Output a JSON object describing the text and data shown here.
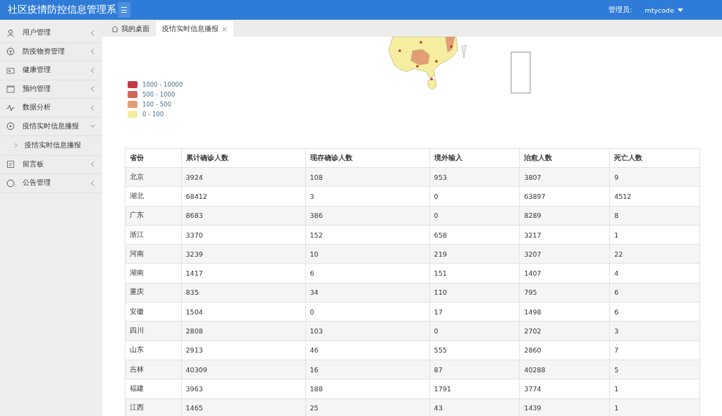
{
  "header": {
    "title": "社区疫情防控信息管理系",
    "menu_toggle": "☰",
    "user_label": "管理员:",
    "user_name": "mtycode"
  },
  "sidebar": {
    "items": [
      {
        "label": "用户管理",
        "expanded": false
      },
      {
        "label": "防疫物资管理",
        "expanded": false
      },
      {
        "label": "健康管理",
        "expanded": false
      },
      {
        "label": "预约管理",
        "expanded": false
      },
      {
        "label": "数据分析",
        "expanded": false
      },
      {
        "label": "疫情实时信息播报",
        "expanded": true,
        "children": [
          {
            "label": "疫情实时信息播报"
          }
        ]
      },
      {
        "label": "留言板",
        "expanded": false
      },
      {
        "label": "公告管理",
        "expanded": false
      }
    ]
  },
  "tabs": [
    {
      "label": "我的桌面",
      "kind": "home",
      "selected": false
    },
    {
      "label": "疫情实时信息播报",
      "kind": "closable",
      "selected": true,
      "close": "×"
    }
  ],
  "legend": [
    {
      "label": "1000 - 10000",
      "color": "#c23b45"
    },
    {
      "label": "500 - 1000",
      "color": "#d2685a"
    },
    {
      "label": "100 - 500",
      "color": "#e29d74"
    },
    {
      "label": "0 - 100",
      "color": "#f5eda0"
    }
  ],
  "table": {
    "columns": [
      "省份",
      "累计确诊人数",
      "现存确诊人数",
      "境外输入",
      "治愈人数",
      "死亡人数"
    ],
    "rows": [
      [
        "北京",
        "3924",
        "108",
        "953",
        "3807",
        "9"
      ],
      [
        "湖北",
        "68412",
        "3",
        "0",
        "63897",
        "4512"
      ],
      [
        "广东",
        "8683",
        "386",
        "0",
        "8289",
        "8"
      ],
      [
        "浙江",
        "3370",
        "152",
        "658",
        "3217",
        "1"
      ],
      [
        "河南",
        "3239",
        "10",
        "219",
        "3207",
        "22"
      ],
      [
        "湖南",
        "1417",
        "6",
        "151",
        "1407",
        "4"
      ],
      [
        "重庆",
        "835",
        "34",
        "110",
        "795",
        "6"
      ],
      [
        "安徽",
        "1504",
        "0",
        "17",
        "1498",
        "6"
      ],
      [
        "四川",
        "2808",
        "103",
        "0",
        "2702",
        "3"
      ],
      [
        "山东",
        "2913",
        "46",
        "555",
        "2860",
        "7"
      ],
      [
        "吉林",
        "40309",
        "16",
        "87",
        "40288",
        "5"
      ],
      [
        "福建",
        "3963",
        "188",
        "1791",
        "3774",
        "1"
      ],
      [
        "江西",
        "1465",
        "25",
        "43",
        "1439",
        "1"
      ]
    ]
  }
}
